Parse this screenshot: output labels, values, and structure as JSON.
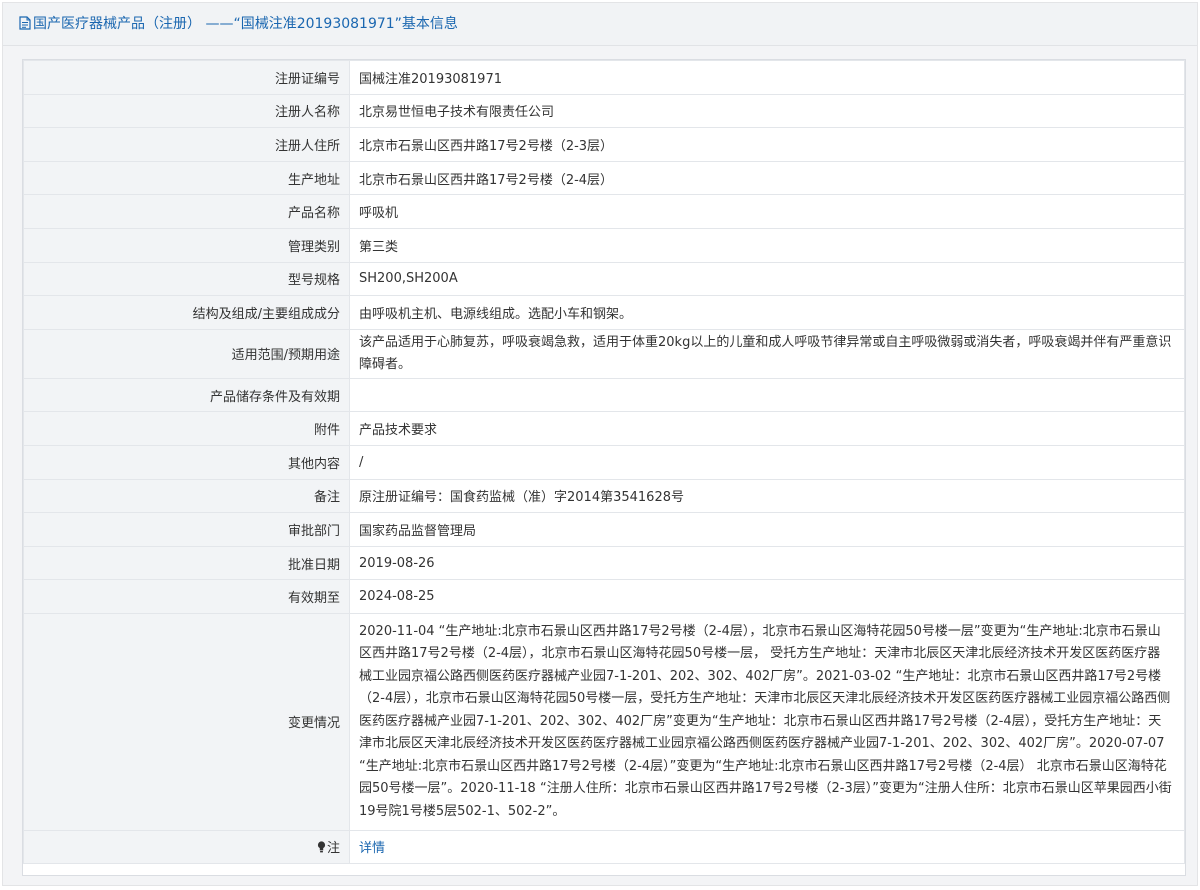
{
  "title": "国产医疗器械产品（注册） ——“国械注准20193081971”基本信息",
  "icons": {
    "title": "document-icon",
    "note": "lightbulb-icon"
  },
  "colors": {
    "accent": "#1b67b0",
    "label_bg": "#f2f4f6",
    "page_bg": "#f3f4f6"
  },
  "rows": [
    {
      "label": "注册证编号",
      "value": "国械注准20193081971"
    },
    {
      "label": "注册人名称",
      "value": "北京易世恒电子技术有限责任公司"
    },
    {
      "label": "注册人住所",
      "value": "北京市石景山区西井路17号2号楼（2-3层）"
    },
    {
      "label": "生产地址",
      "value": "北京市石景山区西井路17号2号楼（2-4层）"
    },
    {
      "label": "产品名称",
      "value": "呼吸机"
    },
    {
      "label": "管理类别",
      "value": "第三类"
    },
    {
      "label": "型号规格",
      "value": "SH200,SH200A"
    },
    {
      "label": "结构及组成/主要组成成分",
      "value": "由呼吸机主机、电源线组成。选配小车和钢架。"
    },
    {
      "label": "适用范围/预期用途",
      "value": "该产品适用于心肺复苏，呼吸衰竭急救，适用于体重20kg以上的儿童和成人呼吸节律异常或自主呼吸微弱或消失者，呼吸衰竭并伴有严重意识障碍者。"
    },
    {
      "label": "产品储存条件及有效期",
      "value": ""
    },
    {
      "label": "附件",
      "value": "产品技术要求"
    },
    {
      "label": "其他内容",
      "value": "/"
    },
    {
      "label": "备注",
      "value": "原注册证编号：国食药监械（准）字2014第3541628号"
    },
    {
      "label": "审批部门",
      "value": "国家药品监督管理局"
    },
    {
      "label": "批准日期",
      "value": "2019-08-26"
    },
    {
      "label": "有效期至",
      "value": "2024-08-25"
    },
    {
      "label": "变更情况",
      "value": "2020-11-04 “生产地址:北京市石景山区西井路17号2号楼（2-4层），北京市石景山区海特花园50号楼一层”变更为“生产地址:北京市石景山区西井路17号2号楼（2-4层），北京市石景山区海特花园50号楼一层， 受托方生产地址：天津市北辰区天津北辰经济技术开发区医药医疗器械工业园京福公路西侧医药医疗器械产业园7-1-201、202、302、402厂房”。2021-03-02 “生产地址：北京市石景山区西井路17号2号楼（2-4层），北京市石景山区海特花园50号楼一层，受托方生产地址：天津市北辰区天津北辰经济技术开发区医药医疗器械工业园京福公路西侧医药医疗器械产业园7-1-201、202、302、402厂房”变更为“生产地址：北京市石景山区西井路17号2号楼（2-4层），受托方生产地址：天津市北辰区天津北辰经济技术开发区医药医疗器械工业园京福公路西侧医药医疗器械产业园7-1-201、202、302、402厂房”。2020-07-07 “生产地址:北京市石景山区西井路17号2号楼（2-4层）”变更为“生产地址:北京市石景山区西井路17号2号楼（2-4层） 北京市石景山区海特花园50号楼一层”。2020-11-18 “注册人住所：北京市石景山区西井路17号2号楼（2-3层）”变更为“注册人住所：北京市石景山区苹果园西小街19号院1号楼5层502-1、502-2”。"
    }
  ],
  "note": {
    "label": "注",
    "link": "详情"
  }
}
